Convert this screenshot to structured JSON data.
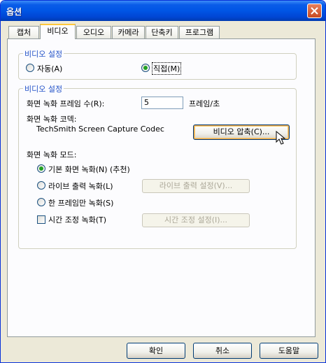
{
  "window": {
    "title": "옵션"
  },
  "tabs": [
    "캡처",
    "비디오",
    "오디오",
    "카메라",
    "단축키",
    "프로그램"
  ],
  "video_settings_1": {
    "legend": "비디오 설정",
    "auto_label": "자동(A)",
    "direct_label": "직접(M)",
    "selected": "direct"
  },
  "video_settings_2": {
    "legend": "비디오 설정",
    "fps_label": "화면 녹화 프레임 수(R):",
    "fps_value": "5",
    "fps_unit": "프레임/초",
    "codec_label": "화면 녹화 코덱:",
    "codec_name": "TechSmith Screen Capture Codec",
    "compress_button": "비디오 압축(C)...",
    "mode_label": "화면 녹화 모드:",
    "mode_basic": "기본 화면 녹화(N) (추천)",
    "mode_live": "라이브 출력 녹화(L)",
    "live_settings_button": "라이브 출력 설정(V)...",
    "mode_single": "한 프레임만 녹화(S)",
    "time_adjust_label": "시간 조정 녹화(T)",
    "time_settings_button": "시간 조정 설정(I)...",
    "selected_mode": "basic"
  },
  "footer": {
    "ok": "확인",
    "cancel": "취소",
    "help": "도움말"
  },
  "colors": {
    "titlebar": "#0055e5",
    "radio_selected": "#21a121",
    "group_label": "#2453c8"
  }
}
